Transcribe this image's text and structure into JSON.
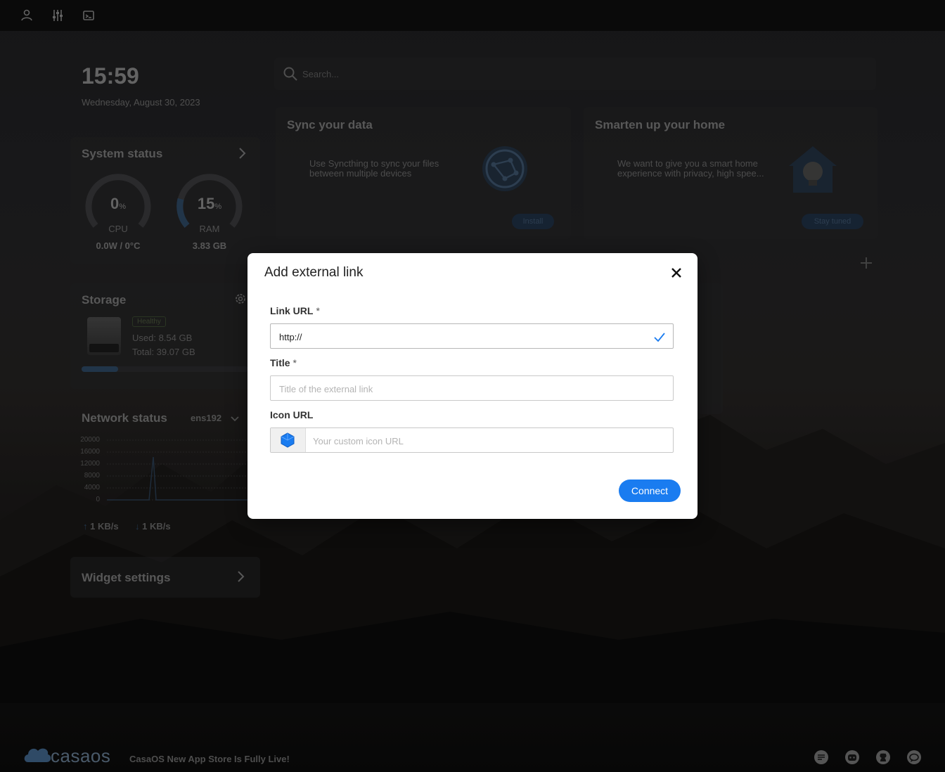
{
  "clock": {
    "time": "15:59",
    "date": "Wednesday, August 30, 2023"
  },
  "system_status": {
    "title": "System status",
    "cpu": {
      "value": "0",
      "unit": "%",
      "label": "CPU",
      "detail": "0.0W / 0°C",
      "usage": 0
    },
    "ram": {
      "value": "15",
      "unit": "%",
      "label": "RAM",
      "detail": "3.83 GB",
      "usage": 0.15
    }
  },
  "storage": {
    "title": "Storage",
    "badge": "Healthy",
    "used": "Used: 8.54 GB",
    "total": "Total: 39.07 GB",
    "usage": 0.22
  },
  "network": {
    "title": "Network status",
    "interface": "ens192",
    "y_ticks": [
      "20000",
      "16000",
      "12000",
      "8000",
      "4000",
      "0"
    ],
    "upload": "1 KB/s",
    "download": "1 KB/s"
  },
  "widget_settings": {
    "title": "Widget settings"
  },
  "search": {
    "placeholder": "Search..."
  },
  "cards": [
    {
      "title": "Sync your data",
      "text": "Use Syncthing to sync your files between multiple devices",
      "button": "Install"
    },
    {
      "title": "Smarten up your home",
      "text": "We want to give you a smart home experience with privacy, high spee...",
      "button": "Stay tuned"
    }
  ],
  "modal": {
    "title": "Add external link",
    "link_label": "Link URL",
    "required_mark": "*",
    "link_value": "http://",
    "title_label": "Title",
    "title_placeholder": "Title of the external link",
    "icon_label": "Icon URL",
    "icon_placeholder": "Your custom icon URL",
    "connect": "Connect"
  },
  "footer": {
    "logo": "casaos",
    "news": "CasaOS New App Store Is Fully Live!"
  },
  "colors": {
    "accent": "#1a7cf0",
    "modal_bg": "#ffffff"
  }
}
